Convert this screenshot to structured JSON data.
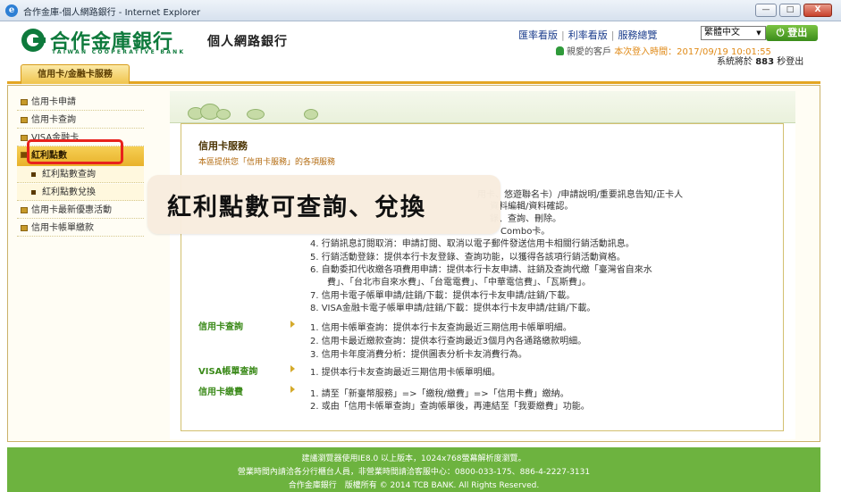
{
  "window": {
    "title": "合作金庫-個人網路銀行 - Internet Explorer",
    "ie_icon": "e",
    "minimize": "—",
    "maximize": "□",
    "close": "X"
  },
  "header": {
    "logo_cn": "合作金庫銀行",
    "logo_en": "TAIWAN COOPERATIVE BANK",
    "bank_title": "個人網路銀行",
    "links": [
      "匯率看版",
      "利率看版",
      "服務總覽"
    ],
    "link_sep": "|",
    "language": "繁體中文",
    "go_label": "✓",
    "logout_label": "登出",
    "welcome_text": "親愛的客戶",
    "last_login_label": "本次登入時間：2017/09/19 10:01:55",
    "countdown_prefix": "系統將於",
    "countdown_value": "883",
    "countdown_suffix": "秒登出"
  },
  "tab": {
    "label": "信用卡/金融卡服務"
  },
  "sidebar": {
    "items": [
      {
        "label": "信用卡申請"
      },
      {
        "label": "信用卡查詢"
      },
      {
        "label": "VISA金融卡"
      },
      {
        "label": "紅利點數"
      },
      {
        "label": "紅利點數查詢"
      },
      {
        "label": "紅利點數兌換"
      },
      {
        "label": "信用卡最新優惠活動"
      },
      {
        "label": "信用卡帳單繳款"
      }
    ]
  },
  "content": {
    "title": "信用卡服務",
    "subtitle": "本區提供您「信用卡服務」的各項服務",
    "callout": "紅利點數可查詢、兌換",
    "apply_lines": [
      "用卡、悠遊聯名卡）/申請說明/重要訊息告知/正卡人",
      "資料編輯/資料確認。",
      "錄、查詢、刪除。",
      "Combo卡。",
      "4.  行銷訊息訂閱取消：申請訂閱、取消以電子郵件發送信用卡相關行銷活動訊息。",
      "5.  行銷活動登錄：提供本行卡友登錄、查詢功能，以獲得各該項行銷活動資格。",
      "6.  自動委扣代收繳各項費用申請：提供本行卡友申請、註銷及查詢代繳「臺灣省自來水",
      "費」、「台北市自來水費」、「台電電費」、「中華電信費」、「瓦斯費」。",
      "7.  信用卡電子帳單申請/註銷/下載：提供本行卡友申請/註銷/下載。",
      "8.  VISA金融卡電子帳單申請/註銷/下載：提供本行卡友申請/註銷/下載。"
    ],
    "sections": [
      {
        "label": "信用卡查詢",
        "lines": [
          "1.  信用卡帳單查詢：提供本行卡友查詢最近三期信用卡帳單明細。",
          "2.  信用卡最近繳款查詢：提供本行查詢最近3個月內各通路繳款明細。",
          "3.  信用卡年度消費分析：提供圖表分析卡友消費行為。"
        ]
      },
      {
        "label": "VISA帳單查詢",
        "lines": [
          "1.  提供本行卡友查詢最近三期信用卡帳單明細。"
        ]
      },
      {
        "label": "信用卡繳費",
        "lines": [
          "1.  請至「新臺幣服務」=>「繳稅/繳費」=>「信用卡費」繳納。",
          "2.  或由「信用卡帳單查詢」查詢帳單後，再連結至「我要繳費」功能。"
        ]
      }
    ]
  },
  "footer": {
    "lines": [
      "建議瀏覽器使用IE8.0 以上版本，1024x768螢幕解析度瀏覽。",
      "營業時間內請洽各分行櫃台人員，非營業時間請洽客服中心：0800-033-175、886-4-2227-3131",
      "合作金庫銀行　版權所有 © 2014 TCB BANK. All Rights Reserved."
    ]
  }
}
